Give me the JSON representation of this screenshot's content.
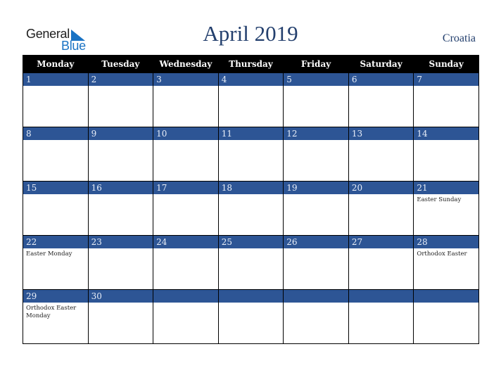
{
  "logo": {
    "part1": "General",
    "part2": "Blue",
    "icon": "triangle-flag-icon"
  },
  "title": "April 2019",
  "country": "Croatia",
  "colors": {
    "header_bg": "#000000",
    "day_bar": "#2d5595",
    "title": "#24406e",
    "logo_blue": "#1a73c4"
  },
  "weekdays": [
    "Monday",
    "Tuesday",
    "Wednesday",
    "Thursday",
    "Friday",
    "Saturday",
    "Sunday"
  ],
  "weeks": [
    [
      {
        "day": "1",
        "holiday": ""
      },
      {
        "day": "2",
        "holiday": ""
      },
      {
        "day": "3",
        "holiday": ""
      },
      {
        "day": "4",
        "holiday": ""
      },
      {
        "day": "5",
        "holiday": ""
      },
      {
        "day": "6",
        "holiday": ""
      },
      {
        "day": "7",
        "holiday": ""
      }
    ],
    [
      {
        "day": "8",
        "holiday": ""
      },
      {
        "day": "9",
        "holiday": ""
      },
      {
        "day": "10",
        "holiday": ""
      },
      {
        "day": "11",
        "holiday": ""
      },
      {
        "day": "12",
        "holiday": ""
      },
      {
        "day": "13",
        "holiday": ""
      },
      {
        "day": "14",
        "holiday": ""
      }
    ],
    [
      {
        "day": "15",
        "holiday": ""
      },
      {
        "day": "16",
        "holiday": ""
      },
      {
        "day": "17",
        "holiday": ""
      },
      {
        "day": "18",
        "holiday": ""
      },
      {
        "day": "19",
        "holiday": ""
      },
      {
        "day": "20",
        "holiday": ""
      },
      {
        "day": "21",
        "holiday": "Easter Sunday"
      }
    ],
    [
      {
        "day": "22",
        "holiday": "Easter Monday"
      },
      {
        "day": "23",
        "holiday": ""
      },
      {
        "day": "24",
        "holiday": ""
      },
      {
        "day": "25",
        "holiday": ""
      },
      {
        "day": "26",
        "holiday": ""
      },
      {
        "day": "27",
        "holiday": ""
      },
      {
        "day": "28",
        "holiday": "Orthodox Easter"
      }
    ],
    [
      {
        "day": "29",
        "holiday": "Orthodox Easter Monday"
      },
      {
        "day": "30",
        "holiday": ""
      },
      {
        "day": "",
        "holiday": ""
      },
      {
        "day": "",
        "holiday": ""
      },
      {
        "day": "",
        "holiday": ""
      },
      {
        "day": "",
        "holiday": ""
      },
      {
        "day": "",
        "holiday": ""
      }
    ]
  ]
}
